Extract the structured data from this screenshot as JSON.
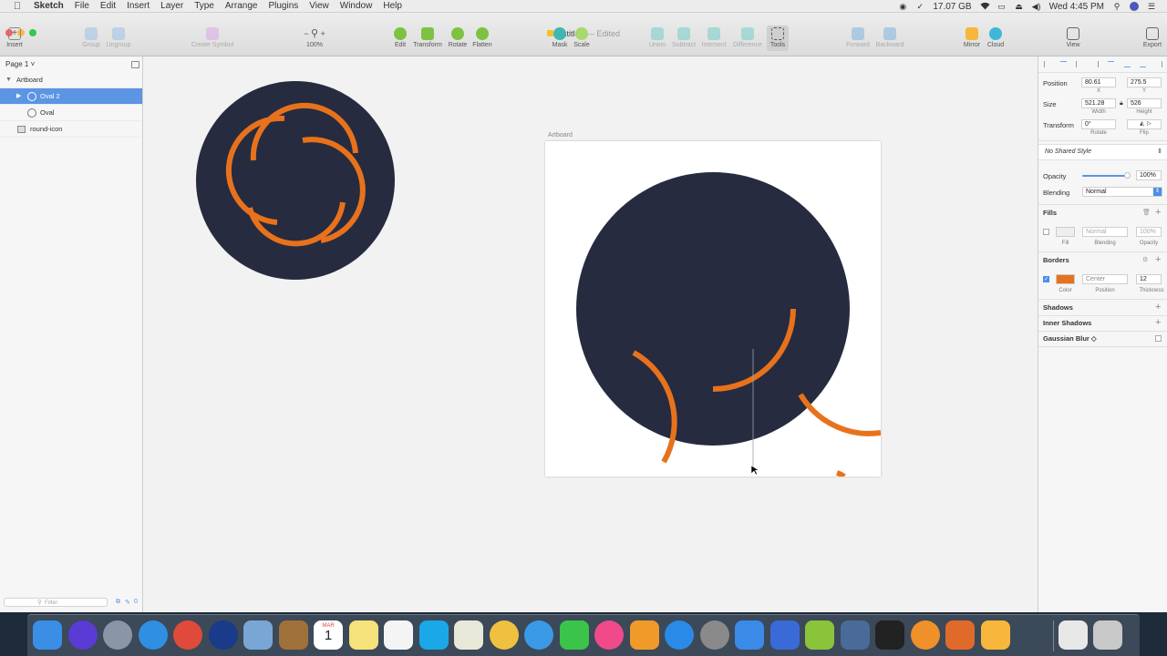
{
  "menubar": {
    "app_name": "Sketch",
    "menus": [
      "File",
      "Edit",
      "Insert",
      "Layer",
      "Type",
      "Arrange",
      "Plugins",
      "View",
      "Window",
      "Help"
    ],
    "status": {
      "battery_size": "17.07 GB",
      "clock": "Wed 4:45 PM"
    },
    "icons": [
      "record-icon",
      "check-icon",
      "disk-icon",
      "wifi-icon",
      "airplay-icon",
      "eject-icon",
      "volume-icon",
      "search-icon",
      "siri-icon",
      "list-icon"
    ]
  },
  "toolbar": {
    "document_title": "Untitled",
    "document_status": "— Edited",
    "insert_label": "Insert",
    "group_label": "Group",
    "ungroup_label": "Ungroup",
    "create_symbol_label": "Create Symbol",
    "zoom_value": "100%",
    "zoom_minus": "−",
    "zoom_plus": "+",
    "edit_label": "Edit",
    "transform_label": "Transform",
    "rotate_label": "Rotate",
    "flatten_label": "Flatten",
    "mask_label": "Mask",
    "scale_label": "Scale",
    "union_label": "Union",
    "subtract_label": "Subtract",
    "intersect_label": "Intersect",
    "difference_label": "Difference",
    "tools_label": "Tools",
    "forward_label": "Forward",
    "backward_label": "Backward",
    "mirror_label": "Mirror",
    "cloud_label": "Cloud",
    "view_label": "View",
    "export_label": "Export"
  },
  "layers": {
    "page_label": "Page 1 ˅",
    "items": [
      {
        "label": "Artboard",
        "icon": "disclosure-open-icon"
      },
      {
        "label": "Oval 2",
        "icon": "oval-icon",
        "selected": true
      },
      {
        "label": "Oval",
        "icon": "oval-icon"
      },
      {
        "label": "round-icon",
        "icon": "image-icon"
      }
    ],
    "filter_placeholder": "Filter",
    "filter_count": "0"
  },
  "canvas": {
    "artboard_name": "Artboard"
  },
  "inspector": {
    "position_label": "Position",
    "x_value": "80.61",
    "y_value": "275.5",
    "x_label": "X",
    "y_label": "Y",
    "size_label": "Size",
    "width_value": "521.28",
    "height_value": "526",
    "width_label": "Width",
    "height_label": "Height",
    "transform_label": "Transform",
    "rotate_value": "0°",
    "rotate_label": "Rotate",
    "flip_label": "Flip",
    "shared_style": "No Shared Style",
    "opacity_label": "Opacity",
    "opacity_value": "100%",
    "opacity_slider_fraction": 1.0,
    "blending_label": "Blending",
    "blending_value": "Normal",
    "fills_header": "Fills",
    "fill_label": "Fill",
    "fill_blending_value": "Normal",
    "fill_blending_label": "Blending",
    "fill_opacity_value": "100%",
    "fill_opacity_label": "Opacity",
    "borders_header": "Borders",
    "border_color_label": "Color",
    "border_position_value": "Center",
    "border_position_label": "Position",
    "border_thickness_value": "12",
    "border_thickness_label": "Thickness",
    "border_color": "#e8721c",
    "shadows_header": "Shadows",
    "inner_shadows_header": "Inner Shadows",
    "gaussian_blur_header": "Gaussian Blur ◇"
  },
  "colors": {
    "navy": "#262b40",
    "orange": "#e8721c",
    "selection_blue": "#5b95e4"
  },
  "dock": {
    "apps": [
      "finder-icon",
      "siri-icon",
      "launchpad-icon",
      "safari-icon",
      "chrome-icon",
      "earth-icon",
      "preview-icon",
      "contacts-icon",
      "calendar-icon",
      "notes-icon",
      "reminders-icon",
      "skype-icon",
      "maps-icon",
      "photos-icon",
      "messages-icon",
      "facetime-icon",
      "itunes-icon",
      "ibooks-icon",
      "app-store-icon",
      "system-preferences-icon",
      "xcode-icon",
      "blueprint-icon",
      "android-studio-icon",
      "migration-icon",
      "terminal-icon",
      "bitcoin-icon",
      "sublime-icon",
      "sketch-icon",
      "quicktime-icon",
      "documents-icon",
      "trash-icon"
    ],
    "calendar_month": "MAR",
    "calendar_day": "1"
  }
}
